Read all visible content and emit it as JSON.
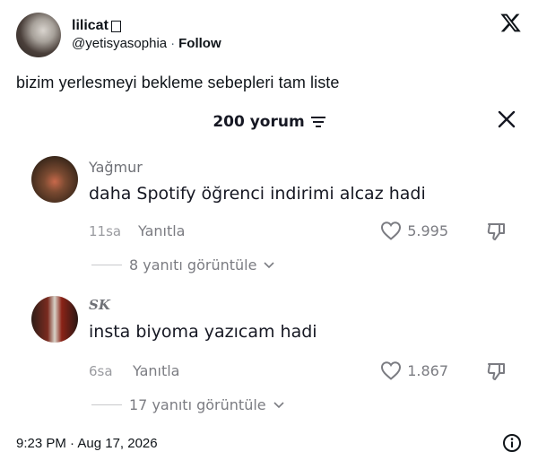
{
  "tweet": {
    "display_name": "lilicat",
    "handle": "@yetisyasophia",
    "separator": "·",
    "follow_label": "Follow",
    "text": "bizim yerlesmeyi bekleme sebepleri tam liste",
    "timestamp": "9:23 PM · Aug 17, 2026"
  },
  "icons": {
    "brand": "x-logo-icon",
    "info": "info-icon",
    "filter": "filter-icon",
    "close": "close-icon",
    "heart": "heart-icon",
    "dislike": "dislike-icon",
    "chevron": "chevron-down-icon"
  },
  "comments_panel": {
    "count_label": "200 yorum",
    "comments": [
      {
        "user": "Yağmur",
        "text": "daha Spotify öğrenci indirimi alcaz hadi",
        "time": "11sa",
        "reply_label": "Yanıtla",
        "likes": "5.995",
        "replies_label": "8 yanıtı görüntüle"
      },
      {
        "user": "SK",
        "text": "insta biyoma yazıcam hadi",
        "time": "6sa",
        "reply_label": "Yanıtla",
        "likes": "1.867",
        "replies_label": "17 yanıtı görüntüle"
      }
    ]
  },
  "colors": {
    "text_primary": "#0f1419",
    "text_muted": "#7b7c82",
    "background": "#ffffff"
  }
}
